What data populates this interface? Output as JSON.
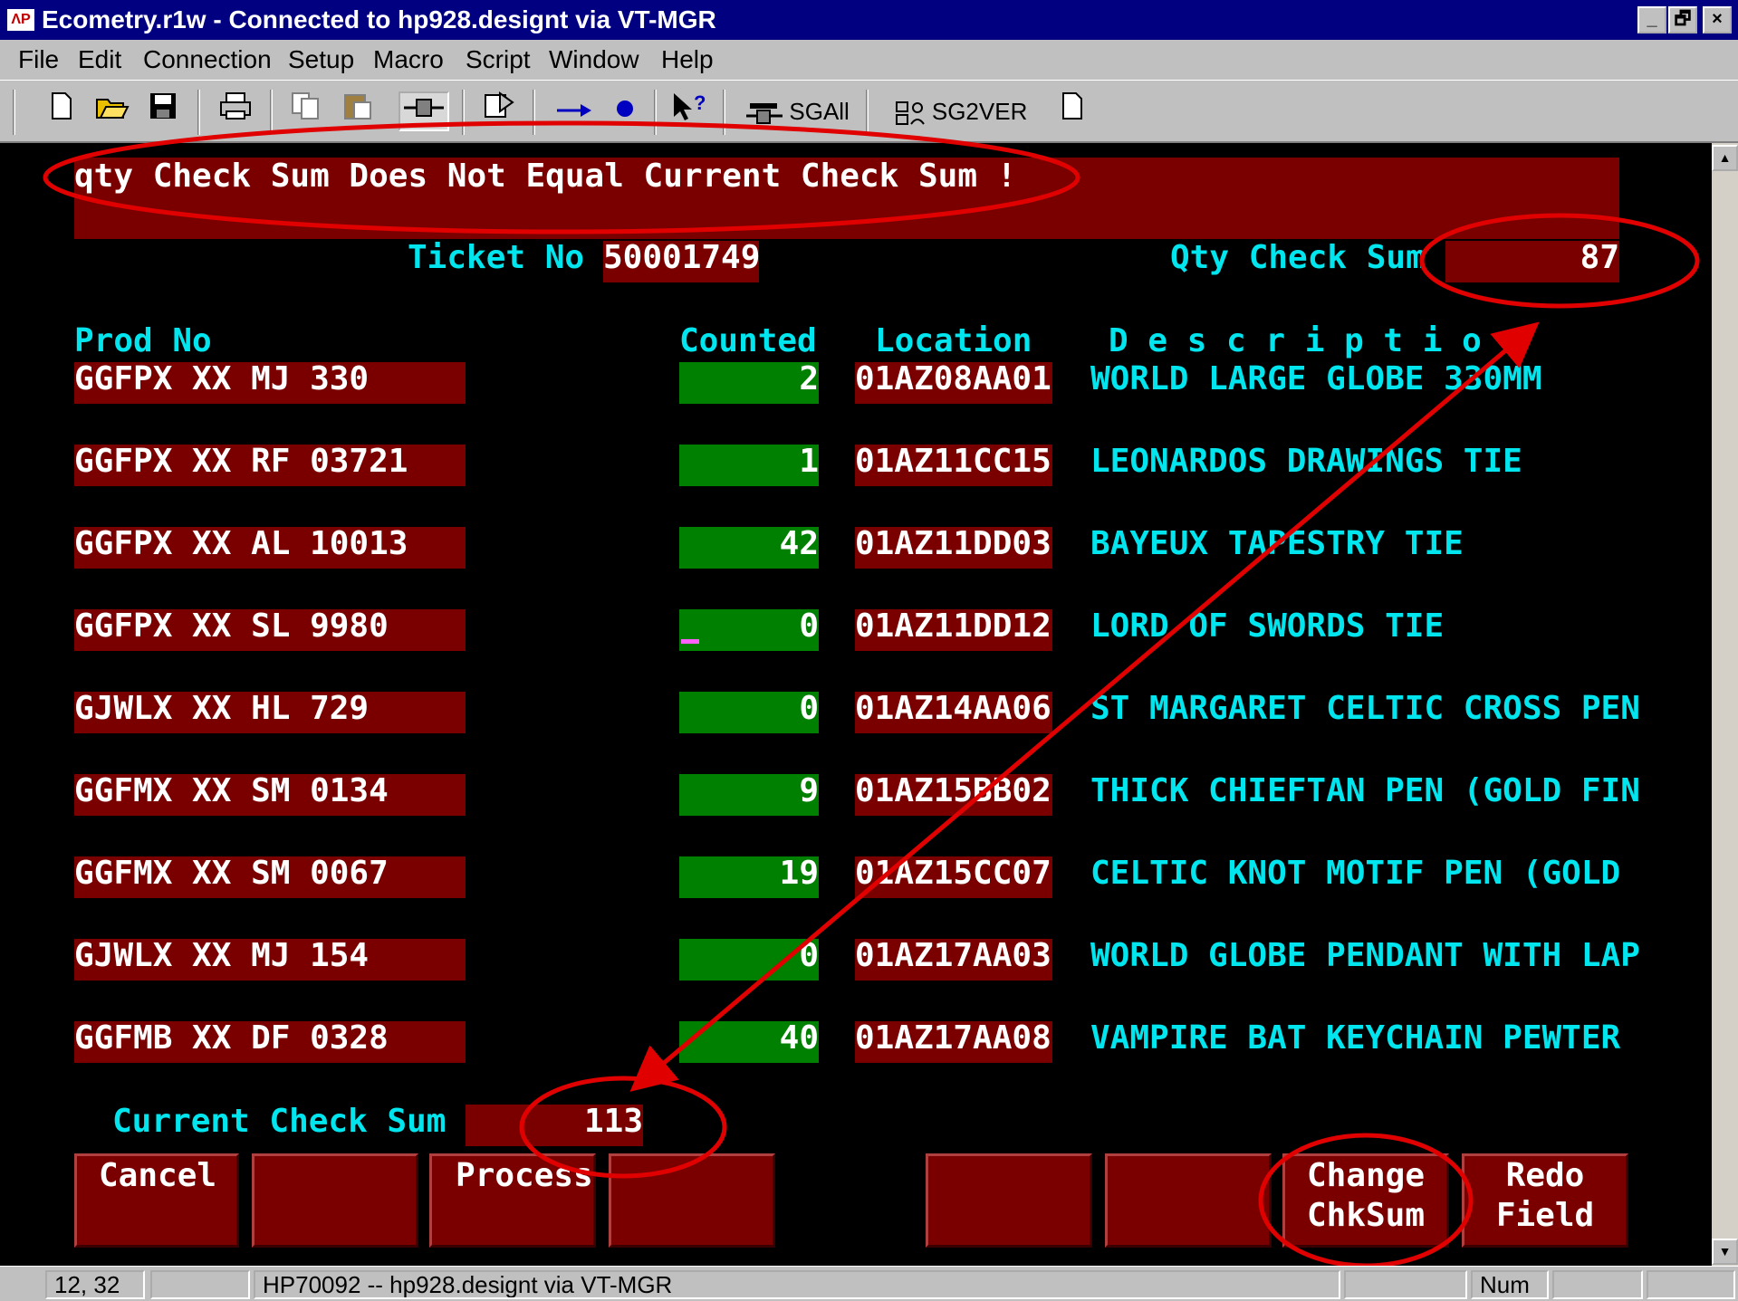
{
  "window": {
    "title": "Ecometry.r1w - Connected to hp928.designt via VT-MGR",
    "app_icon_text": "ΛP",
    "buttons": {
      "minimize": "_",
      "maximize": "🗗",
      "close": "×"
    }
  },
  "menu": [
    "File",
    "Edit",
    "Connection",
    "Setup",
    "Macro",
    "Script",
    "Window",
    "Help"
  ],
  "toolbar": {
    "items": [
      "new-file",
      "open-folder",
      "save",
      "print",
      "copy",
      "paste",
      "connect",
      "script",
      "play",
      "record",
      "help"
    ],
    "sgall_label": "SGAll",
    "sg2ver_label": "SG2VER"
  },
  "terminal": {
    "message": "qty Check Sum Does Not Equal Current Check Sum !",
    "ticket_label": "Ticket No",
    "ticket_no": "50001749",
    "qty_check_label": "Qty Check Sum",
    "qty_check_sum": "87",
    "headers": {
      "prod_no": "Prod No",
      "counted": "Counted",
      "location": "Location",
      "description": "D e s c r i p t i o n"
    },
    "rows": [
      {
        "prod": "GGFPX XX MJ 330",
        "counted": "2",
        "location": "01AZ08AA01",
        "description": "WORLD LARGE GLOBE 330MM"
      },
      {
        "prod": "GGFPX XX RF 03721",
        "counted": "1",
        "location": "01AZ11CC15",
        "description": "LEONARDOS DRAWINGS TIE"
      },
      {
        "prod": "GGFPX XX AL 10013",
        "counted": "42",
        "location": "01AZ11DD03",
        "description": "BAYEUX TAPESTRY TIE"
      },
      {
        "prod": "GGFPX XX SL 9980",
        "counted": "0",
        "location": "01AZ11DD12",
        "description": "LORD OF SWORDS TIE"
      },
      {
        "prod": "GJWLX XX HL 729",
        "counted": "0",
        "location": "01AZ14AA06",
        "description": "ST MARGARET CELTIC CROSS PEN"
      },
      {
        "prod": "GGFMX XX SM 0134",
        "counted": "9",
        "location": "01AZ15BB02",
        "description": "THICK CHIEFTAN PEN (GOLD FIN"
      },
      {
        "prod": "GGFMX XX SM 0067",
        "counted": "19",
        "location": "01AZ15CC07",
        "description": "CELTIC KNOT MOTIF PEN (GOLD"
      },
      {
        "prod": "GJWLX XX MJ 154",
        "counted": "0",
        "location": "01AZ17AA03",
        "description": "WORLD GLOBE PENDANT WITH LAP"
      },
      {
        "prod": "GGFMB XX DF 0328",
        "counted": "40",
        "location": "01AZ17AA08",
        "description": "VAMPIRE BAT KEYCHAIN PEWTER"
      }
    ],
    "current_check_label": "Current Check Sum",
    "current_check_sum": "113",
    "function_keys": {
      "f1": "Cancel",
      "f3": "Process",
      "f7_line1": "Change",
      "f7_line2": "ChkSum",
      "f8_line1": "Redo",
      "f8_line2": "Field"
    }
  },
  "statusbar": {
    "cursor_pos": "12, 32",
    "connection": "HP70092 -- hp928.designt via VT-MGR",
    "num": "Num"
  },
  "annotation_color": "#e00000"
}
